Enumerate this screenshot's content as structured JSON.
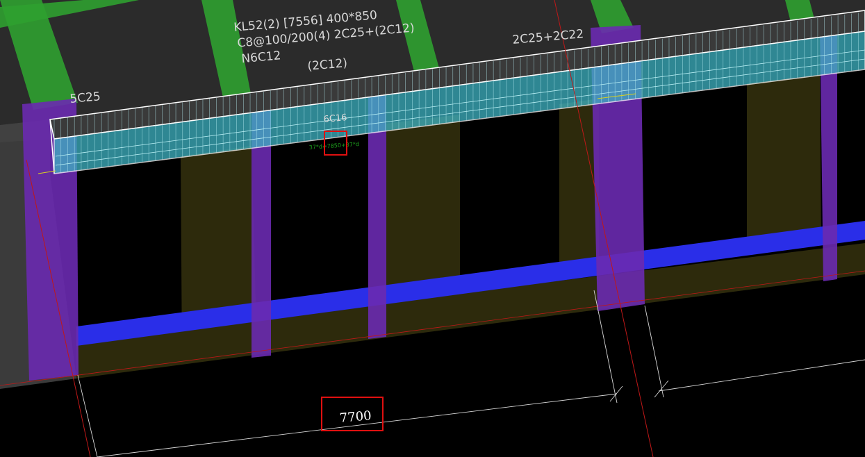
{
  "beam_annotation": {
    "line1": "KL52(2) [7556] 400*850",
    "line2": "C8@100/200(4) 2C25+(2C12)",
    "line3": "N6C12"
  },
  "rebar_labels": {
    "left_bottom": "5C25",
    "mid_top": "(2C12)",
    "right_top": "2C25+2C22",
    "small_mid": "6C16"
  },
  "small_green_text": {
    "line1": "",
    "line2": "37*d=7850+37*d"
  },
  "dimension": {
    "value": "7700"
  },
  "colors": {
    "background": "#000000",
    "beam_fill": "#3fb4c4",
    "column": "#6a2ab0",
    "green_beam": "#2fa030",
    "blue_strip": "#2a2ee8",
    "olive_wall": "#2d2a0c",
    "axis_line": "#c01818",
    "highlight_box": "#e01010"
  }
}
